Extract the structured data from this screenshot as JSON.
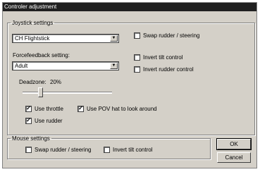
{
  "window": {
    "title": "Controler adjustment"
  },
  "joystick": {
    "group_label": "Joystick settings",
    "device_value": "CH Flightstick",
    "forcefeedback_label": "Forcefeedback setting:",
    "forcefeedback_value": "Adult",
    "deadzone_label": "Deadzone:",
    "deadzone_value": "20%",
    "deadzone_level": 0.2,
    "swap_rudder_label": "Swap rudder / steering",
    "swap_rudder_checked": false,
    "invert_tilt_label": "Invert tilt control",
    "invert_tilt_checked": false,
    "invert_rudder_label": "Invert rudder control",
    "invert_rudder_checked": false,
    "use_throttle_label": "Use throttle",
    "use_throttle_checked": true,
    "use_pov_label": "Use POV hat to look around",
    "use_pov_checked": true,
    "use_rudder_label": "Use rudder",
    "use_rudder_checked": true
  },
  "mouse": {
    "group_label": "Mouse settings",
    "swap_rudder_label": "Swap rudder / steering",
    "swap_rudder_checked": false,
    "invert_tilt_label": "Invert tilt control",
    "invert_tilt_checked": false
  },
  "buttons": {
    "ok_label": "OK",
    "cancel_label": "Cancel"
  }
}
